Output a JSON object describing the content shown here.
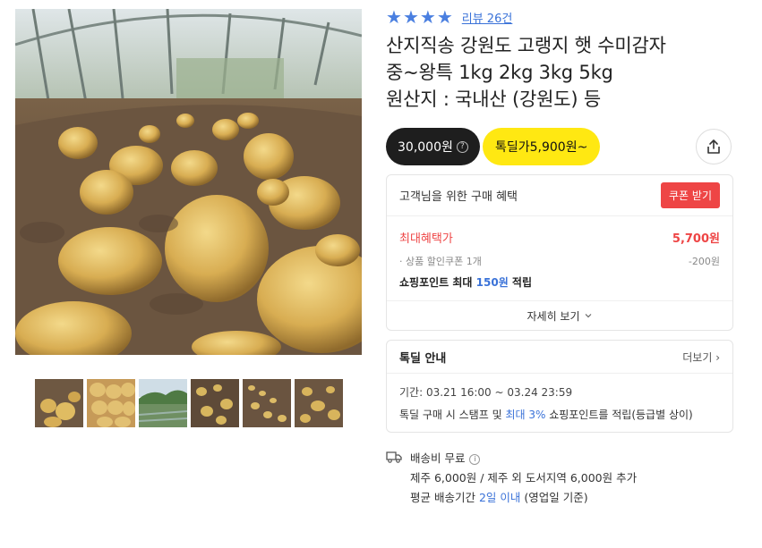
{
  "product": {
    "rating_stars": 4,
    "review_link": "리뷰 26건",
    "title_lines": [
      "산지직송 강원도 고랭지 햇 수미감자",
      "중~왕특 1kg 2kg 3kg 5kg",
      "원산지 : 국내산 (강원도) 등"
    ]
  },
  "price": {
    "original": "30,000원",
    "info_icon": "question-icon",
    "deal": "톡딜가5,900원~",
    "share_icon": "share-icon",
    "colors": {
      "dark": "#1e1e1e",
      "deal_yellow": "#ffe812",
      "accent_red": "#ee4545",
      "accent_blue": "#3a72d8"
    }
  },
  "benefit": {
    "title": "고객님을 위한 구매 혜택",
    "coupon_button": "쿠폰 받기",
    "max_label": "최대혜택가",
    "max_value": "5,700원",
    "coupon_label": "상품 할인쿠폰 1개",
    "coupon_value": "-200원",
    "points_prefix": "쇼핑포인트 최대 ",
    "points_amount": "150원",
    "points_suffix": " 적립",
    "more": "자세히 보기"
  },
  "deal": {
    "title": "톡딜 안내",
    "more": "더보기",
    "period": "기간: 03.21 16:00 ~ 03.24 23:59",
    "desc_prefix": "톡딜 구매 시 스탬프 및 ",
    "desc_highlight": "최대 3%",
    "desc_suffix": " 쇼핑포인트를 적립(등급별 상이)"
  },
  "shipping": {
    "icon": "truck-icon",
    "fee": "배송비 무료",
    "extra": "제주 6,000원 / 제주 외 도서지역 6,000원 추가",
    "period_prefix": "평균 배송기간 ",
    "period_highlight": "2일 이내",
    "period_suffix": " (영업일 기준)"
  },
  "gallery": {
    "thumbnails": [
      "thumbnail-1",
      "thumbnail-2",
      "thumbnail-3",
      "thumbnail-4",
      "thumbnail-5",
      "thumbnail-6"
    ]
  }
}
